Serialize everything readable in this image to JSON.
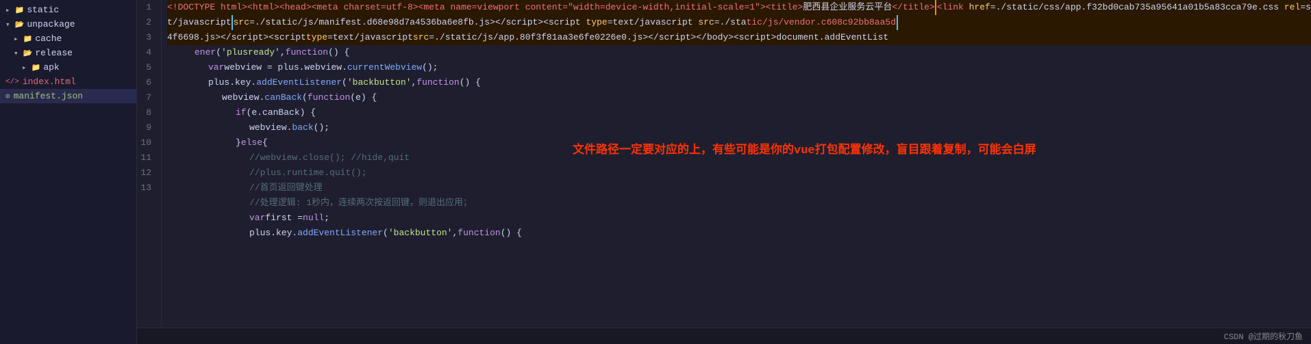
{
  "sidebar": {
    "items": [
      {
        "label": "static",
        "type": "folder",
        "indent": 1,
        "open": false
      },
      {
        "label": "unpackage",
        "type": "folder",
        "indent": 1,
        "open": true
      },
      {
        "label": "cache",
        "type": "folder",
        "indent": 2,
        "open": false
      },
      {
        "label": "release",
        "type": "folder",
        "indent": 2,
        "open": true
      },
      {
        "label": "apk",
        "type": "folder",
        "indent": 3,
        "open": false
      },
      {
        "label": "index.html",
        "type": "html",
        "indent": 1,
        "open": false
      },
      {
        "label": "manifest.json",
        "type": "json",
        "indent": 1,
        "open": false
      }
    ]
  },
  "code": {
    "lines": [
      "1",
      "2",
      "3",
      "4",
      "5",
      "6",
      "7",
      "8",
      "9",
      "10",
      "11",
      "12",
      "13"
    ]
  },
  "annotation": {
    "text": "文件路径一定要对应的上，有些可能是你的vue打包配置修改，盲目跟着复制，可能会白屏"
  },
  "status": {
    "text": "CSDN @过期的秋刀鱼"
  }
}
